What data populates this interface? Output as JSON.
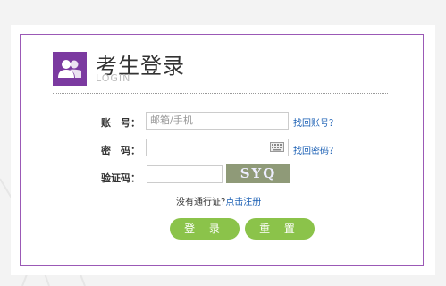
{
  "header": {
    "title": "考生登录",
    "subtitle": "LOGIN",
    "icon": "users-icon"
  },
  "form": {
    "account_label": "账　号：",
    "account_placeholder": "邮箱/手机",
    "find_account": "找回账号？",
    "password_label": "密　码：",
    "find_password": "找回密码？",
    "captcha_label": "验证码：",
    "captcha_text": "SYQ"
  },
  "register": {
    "prompt": "没有通行证?",
    "link": "点击注册"
  },
  "buttons": {
    "login": "登 录",
    "reset": "重 置"
  },
  "colors": {
    "accent": "#7b3aa0",
    "button": "#8bc34a",
    "link": "#1a5fb4"
  }
}
